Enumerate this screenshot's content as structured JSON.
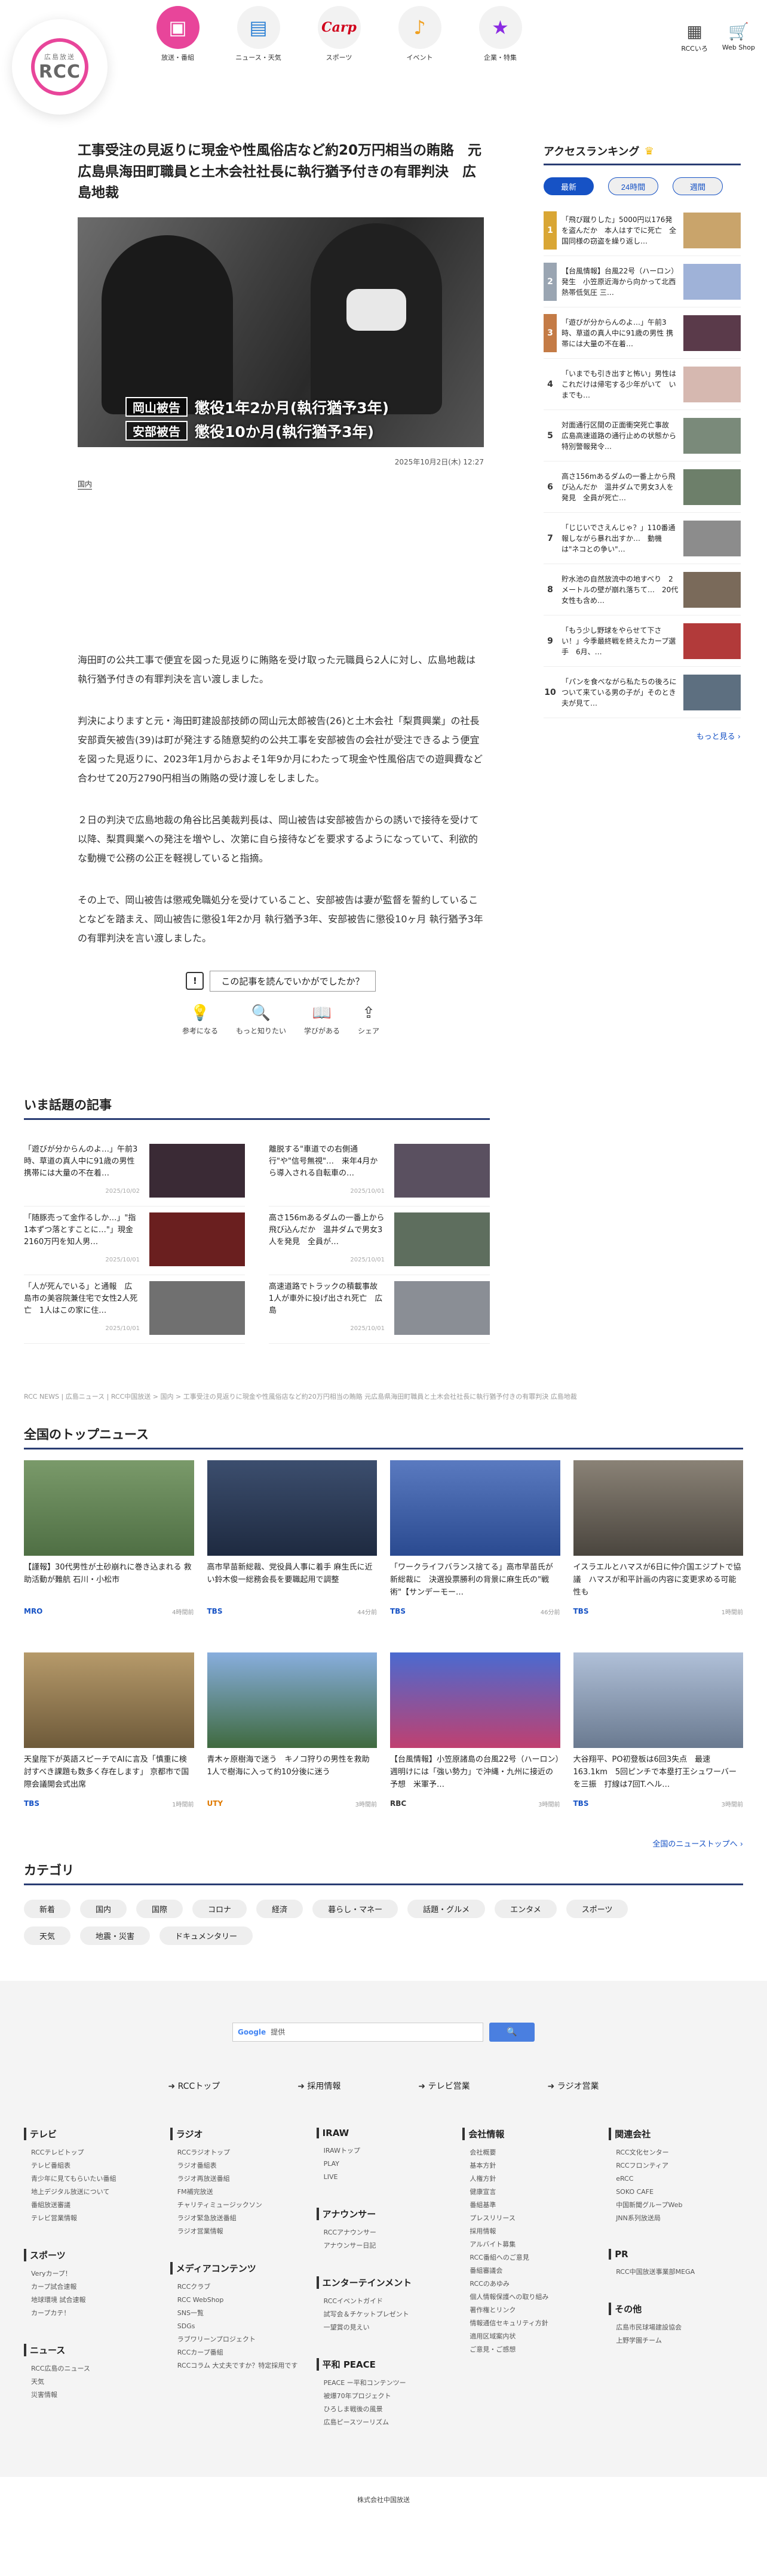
{
  "header": {
    "logo_sub": "広島放送",
    "logo_main": "RCC",
    "nav": [
      {
        "label": "放送・番組",
        "icon": "tv-icon",
        "glyph": "▣"
      },
      {
        "label": "ニュース・天気",
        "icon": "news-icon",
        "glyph": "▤"
      },
      {
        "label": "スポーツ",
        "icon": "carp-icon",
        "glyph": "Carp"
      },
      {
        "label": "イベント",
        "icon": "music-icon",
        "glyph": "♪"
      },
      {
        "label": "企業・特集",
        "icon": "star-icon",
        "glyph": "★"
      }
    ],
    "right_links": [
      {
        "label": "RCCいろ",
        "icon": "apps-icon",
        "glyph": "▦"
      },
      {
        "label": "Web Shop",
        "icon": "cart-icon",
        "glyph": "🛒"
      }
    ]
  },
  "article": {
    "title": "工事受注の見返りに現金や性風俗店など約20万円相当の賄賂　元広島県海田町職員と土木会社社長に執行猶予付きの有罪判決　広島地裁",
    "caption1_name": "岡山被告",
    "caption1_text": "懲役1年2か月(執行猶予3年)",
    "caption2_name": "安部被告",
    "caption2_text": "懲役10か月(執行猶予3年)",
    "date": "2025年10月2日(木) 12:27",
    "category": "国内",
    "body": [
      "海田町の公共工事で便宜を図った見返りに賄賂を受け取った元職員ら2人に対し、広島地裁は執行猶予付きの有罪判決を言い渡しました。",
      "判決によりますと元・海田町建設部技師の岡山元太郎被告(26)と土木会社「梨貫興業」の社長 安部貢矢被告(39)は町が発注する随意契約の公共工事を安部被告の会社が受注できるよう便宜を図った見返りに、2023年1月からおよそ1年9か月にわたって現金や性風俗店での遊興費など合わせて20万2790円相当の賄賂の受け渡しをしました。",
      "２日の判決で広島地裁の角谷比呂美裁判長は、岡山被告は安部被告からの誘いで接待を受けて以降、梨貫興業への発注を増やし、次第に自ら接待などを要求するようになっていて、利欲的な動機で公務の公正を軽視していると指摘。",
      "その上で、岡山被告は懲戒免職処分を受けていること、安部被告は妻が監督を誓約していることなどを踏まえ、岡山被告に懲役1年2か月 執行猶予3年、安部被告に懲役10ヶ月 執行猶予3年の有罪判決を言い渡しました。"
    ],
    "feedback_question": "この記事を読んでいかがでしたか？",
    "feedback_buttons": [
      {
        "label": "参考になる",
        "icon": "lightbulb-icon",
        "glyph": "💡"
      },
      {
        "label": "もっと知りたい",
        "icon": "magnifier-icon",
        "glyph": "🔍"
      },
      {
        "label": "学びがある",
        "icon": "book-icon",
        "glyph": "📖"
      },
      {
        "label": "シェア",
        "icon": "share-icon",
        "glyph": "⇪"
      }
    ]
  },
  "ranking": {
    "title": "アクセスランキング",
    "tabs": [
      "最新",
      "24時間",
      "週間"
    ],
    "items": [
      {
        "num": "1",
        "text": "「飛び蹴りした」5000円以176発を盗んだか　本人はすでに死亡　全国同様の窃盗を繰り返し…"
      },
      {
        "num": "2",
        "text": "【台風情報】台風22号（ハーロン）発生　小笠原近海から向かって北西　熱帯低気圧 三…"
      },
      {
        "num": "3",
        "text": "「遊びが分からんのよ…」午前3時、草道の真人中に91歳の男性 携帯には大量の不在着…"
      },
      {
        "num": "4",
        "text": "「いまでも引き出すと怖い」男性はこれだけは帰宅する少年がいて　いまでも…"
      },
      {
        "num": "5",
        "text": "対面通行区間の正面衝突死亡事故　広島高速道路の通行止めの状態から特別警報発令…"
      },
      {
        "num": "6",
        "text": "高さ156mあるダムの一番上から飛び込んだか　温井ダムで男女3人を発見　全員が死亡…"
      },
      {
        "num": "7",
        "text": "「じじいでさえんじゃ？」110番通報しながら暴れ出すか…　動機は\"ネコとの争い\"…"
      },
      {
        "num": "8",
        "text": "貯水池の自然放流中の地すべり　2メートルの壁が崩れ落ちて…　20代女性も含め…"
      },
      {
        "num": "9",
        "text": "「もう少し野球をやらせて下さい！」今季最終戦を終えたカープ選手　6月、…"
      },
      {
        "num": "10",
        "text": "「パンを食べながら私たちの後ろについて来ている男の子が」そのとき夫が見て…"
      }
    ],
    "more": "もっと見る ›"
  },
  "hot": {
    "title": "いま話題の記事",
    "items": [
      {
        "text": "「遊びが分からんのよ…」午前3時、草道の真人中に91歳の男性　携帯には大量の不在着…",
        "date": "2025/10/02"
      },
      {
        "text": "離脱する\"車道での右側通行\"や\"信号無視\"…　来年4月から導入される自転車の…",
        "date": "2025/10/01"
      },
      {
        "text": "「随豚売って金作るしか…」\"指1本ずつ落とすことに…\"」現金2160万円を知人男…",
        "date": "2025/10/01"
      },
      {
        "text": "高さ156mあるダムの一番上から飛び込んだか　温井ダムで男女3人を発見　全員が…",
        "date": "2025/10/01"
      },
      {
        "text": "「人が死んでいる」と通報　広島市の美容院兼住宅で女性2人死亡　1人はこの家に住…",
        "date": "2025/10/01"
      },
      {
        "text": "高速道路でトラックの積載事故　1人が車外に投げ出され死亡　広島",
        "date": "2025/10/01"
      }
    ]
  },
  "breadcrumb": "RCC NEWS | 広島ニュース | RCC中国放送 > 国内 > 工事受注の見返りに現金や性風俗店など約20万円相当の賄賂 元広島県海田町職員と土木会社社長に執行猶予付きの有罪判決 広島地裁",
  "top_news": {
    "title": "全国のトップニュース",
    "items": [
      {
        "text": "【謹報】30代男性が土砂崩れに巻き込まれる 救助活動が難航 石川・小松市",
        "source": "MRO",
        "time": "4時間前"
      },
      {
        "text": "高市早苗新総裁、党役員人事に着手 麻生氏に近い鈴木俊一総務会長を要職起用で調整",
        "source": "TBS",
        "time": "44分前"
      },
      {
        "text": "「ワークライフバランス捨てる」高市早苗氏が新総裁に　決選投票勝利の背景に麻生氏の\"戦術\"【サンデーモー…",
        "source": "TBS",
        "time": "46分前"
      },
      {
        "text": "イスラエルとハマスが6日に仲介国エジプトで協議　ハマスが和平計画の内容に変更求める可能性も",
        "source": "TBS",
        "time": "1時間前"
      },
      {
        "text": "天皇陛下が英語スピーチでAIに言及「慎重に検討すべき課題も数多く存在します」 京都市で国際会議開会式出席",
        "source": "TBS",
        "time": "1時間前"
      },
      {
        "text": "青木ヶ原樹海で迷う　キノコ狩りの男性を救助　1人で樹海に入って約10分後に迷う",
        "source": "UTY",
        "time": "3時間前"
      },
      {
        "text": "【台風情報】小笠原諸島の台風22号（ハーロン）週明けには「強い勢力」で沖縄・九州に接近の予想　米軍予…",
        "source": "RBC",
        "time": "3時間前"
      },
      {
        "text": "大谷翔平、PO初登板は6回3失点　最速163.1km　5回ピンチで本塁打王シュワーバーを三振　打線は7回T.ヘル…",
        "source": "TBS",
        "time": "3時間前"
      }
    ],
    "more": "全国のニューストップへ ›"
  },
  "categories": {
    "title": "カテゴリ",
    "items": [
      "新着",
      "国内",
      "国際",
      "コロナ",
      "経済",
      "暮らし・マネー",
      "話題・グルメ",
      "エンタメ",
      "スポーツ",
      "天気",
      "地震・災害",
      "ドキュメンタリー"
    ]
  },
  "footer": {
    "search_brand": "Google",
    "search_placeholder": "提供",
    "search_button": "🔍",
    "top_links": [
      "RCCトップ",
      "採用情報",
      "テレビ営業",
      "ラジオ営業"
    ],
    "columns": [
      [
        {
          "head": "テレビ",
          "links": [
            "RCCテレビトップ",
            "テレビ番組表",
            "青少年に見てもらいたい番組",
            "地上デジタル放送について",
            "番組放送審議",
            "テレビ営業情報"
          ]
        },
        {
          "head": "スポーツ",
          "links": [
            "Veryカープ！",
            "カープ試合速報",
            "地球環境 試合速報",
            "カープカテ！"
          ]
        },
        {
          "head": "ニュース",
          "links": [
            "RCC広島のニュース",
            "天気",
            "災害情報"
          ]
        }
      ],
      [
        {
          "head": "ラジオ",
          "links": [
            "RCCラジオトップ",
            "ラジオ番組表",
            "ラジオ再放送番組",
            "FM補完放送",
            "チャリティミュージックソン",
            "ラジオ緊急放送番組",
            "ラジオ営業情報"
          ]
        },
        {
          "head": "メディアコンテンツ",
          "links": [
            "RCCクラブ",
            "RCC WebShop",
            "SNS一覧",
            "SDGs",
            "ラブワリーンプロジェクト",
            "RCCカープ番組",
            "RCCコラム 大丈夫ですか？特定採用です"
          ]
        }
      ],
      [
        {
          "head": "IRAW",
          "links": [
            "IRAWトップ",
            "PLAY",
            "LIVE"
          ]
        },
        {
          "head": "アナウンサー",
          "links": [
            "RCCアナウンサー",
            "アナウンサー日記"
          ]
        },
        {
          "head": "エンターテインメント",
          "links": [
            "RCCイベントガイド",
            "試写会＆チケットプレゼント",
            "一望賞の見えい"
          ]
        },
        {
          "head": "平和 PEACE",
          "links": [
            "PEACE ー平和コンテンツー",
            "被爆70年プロジェクト",
            "ひろしま戦後の風景",
            "広島ピースツーリズム"
          ]
        }
      ],
      [
        {
          "head": "会社情報",
          "links": [
            "会社概要",
            "基本方針",
            "人権方針",
            "健康宣言",
            "番組基準",
            "プレスリリース",
            "採用情報",
            "アルバイト募集",
            "RCC番組へのご意見",
            "番組審議会",
            "RCCのあゆみ",
            "個人情報保護への取り組み",
            "著作権とリンク",
            "情報通信セキュリティ方針",
            "適用区域案内状",
            "ご意見・ご感想"
          ]
        }
      ],
      [
        {
          "head": "関連会社",
          "links": [
            "RCC文化センター",
            "RCCフロンティア",
            "eRCC",
            "SOKO CAFE",
            "中国新聞グループWeb",
            "JNN系列放送局"
          ]
        },
        {
          "head": "PR",
          "links": [
            "RCC中国放送事業部MEGA"
          ]
        },
        {
          "head": "その他",
          "links": [
            "広島市民球場建設協会",
            "上野学園チーム"
          ]
        }
      ]
    ],
    "copyright": "株式会社中国放送"
  }
}
